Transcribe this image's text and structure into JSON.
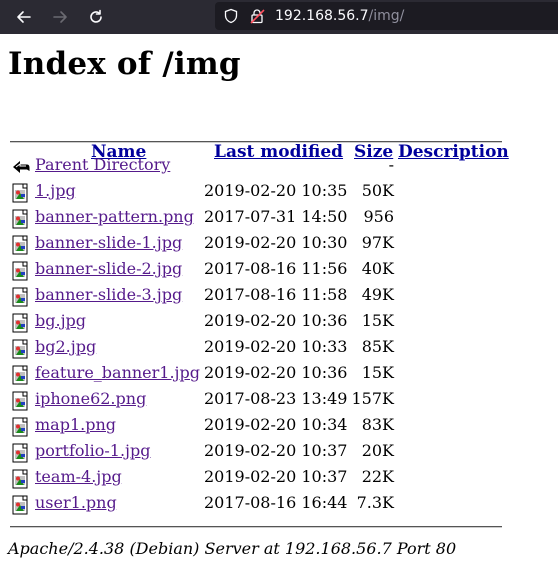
{
  "browser": {
    "url_host": "192.168.56.7",
    "url_path": "/img/"
  },
  "page": {
    "title": "Index of /img",
    "columns": {
      "name": "Name",
      "last_modified": "Last modified",
      "size": "Size",
      "description": "Description"
    },
    "parent": {
      "name": "Parent Directory",
      "size": "-"
    },
    "files": [
      {
        "name": "1.jpg",
        "modified": "2019-02-20 10:35",
        "size": "50K"
      },
      {
        "name": "banner-pattern.png",
        "modified": "2017-07-31 14:50",
        "size": "956"
      },
      {
        "name": "banner-slide-1.jpg",
        "modified": "2019-02-20 10:30",
        "size": "97K"
      },
      {
        "name": "banner-slide-2.jpg",
        "modified": "2017-08-16 11:56",
        "size": "40K"
      },
      {
        "name": "banner-slide-3.jpg",
        "modified": "2017-08-16 11:58",
        "size": "49K"
      },
      {
        "name": "bg.jpg",
        "modified": "2019-02-20 10:36",
        "size": "15K"
      },
      {
        "name": "bg2.jpg",
        "modified": "2019-02-20 10:33",
        "size": "85K"
      },
      {
        "name": "feature_banner1.jpg",
        "modified": "2019-02-20 10:36",
        "size": "15K"
      },
      {
        "name": "iphone62.png",
        "modified": "2017-08-23 13:49",
        "size": "157K"
      },
      {
        "name": "map1.png",
        "modified": "2019-02-20 10:34",
        "size": "83K"
      },
      {
        "name": "portfolio-1.jpg",
        "modified": "2019-02-20 10:37",
        "size": "20K"
      },
      {
        "name": "team-4.jpg",
        "modified": "2019-02-20 10:37",
        "size": "22K"
      },
      {
        "name": "user1.png",
        "modified": "2017-08-16 16:44",
        "size": "7.3K"
      }
    ],
    "footer": "Apache/2.4.38 (Debian) Server at 192.168.56.7 Port 80"
  }
}
